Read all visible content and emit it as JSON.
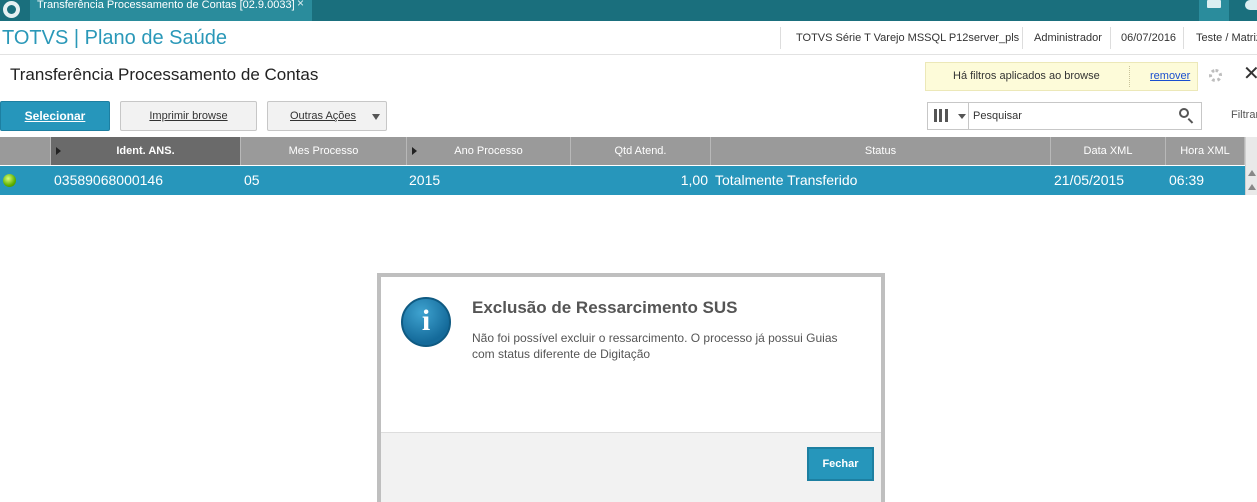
{
  "window": {
    "tab_title": "Transferência Processamento de Contas [02.9.0033]",
    "tab_close": "×"
  },
  "header": {
    "brand": "TOTVS | Plano de Saúde",
    "environment": "TOTVS Série T Varejo MSSQL P12server_pls",
    "user": "Administrador",
    "date": "06/07/2016",
    "branch": "Teste / Matriz"
  },
  "page": {
    "title": "Transferência Processamento de Contas"
  },
  "filter_notice": {
    "text": "Há filtros aplicados ao browse",
    "remove_label": "remover"
  },
  "toolbar": {
    "select_label": "Selecionar",
    "print_label": "Imprimir browse",
    "other_actions_label": "Outras Ações",
    "search_value": "Pesquisar",
    "filter_label": "Filtrar"
  },
  "grid": {
    "columns": [
      "Ident. ANS.",
      "Mes Processo",
      "Ano Processo",
      "Qtd Atend.",
      "Status",
      "Data XML",
      "Hora XML"
    ],
    "rows": [
      {
        "ident_ans": "03589068000146",
        "mes": "05",
        "ano": "2015",
        "qtd": "1,00",
        "status": "Totalmente Transferido",
        "data_xml": "21/05/2015",
        "hora_xml": "06:39",
        "status_color": "#5fb000"
      }
    ]
  },
  "dialog": {
    "title": "Exclusão de Ressarcimento SUS",
    "message": "Não foi possível excluir o ressarcimento. O processo já possui Guias com status diferente de Digitação",
    "icon": "i",
    "close_label": "Fechar"
  },
  "colors": {
    "accent": "#2696bb",
    "titlebar": "#1a6f7d",
    "brand": "#2a98b8"
  }
}
